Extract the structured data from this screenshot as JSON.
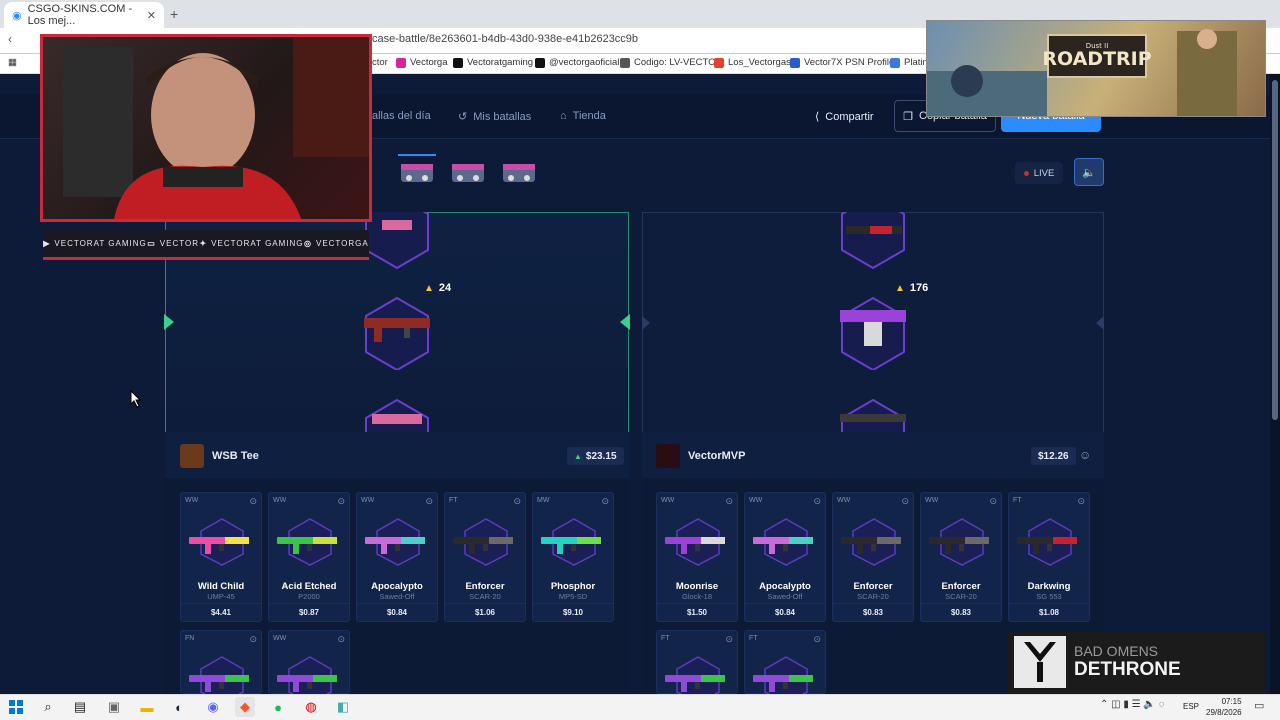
{
  "browser": {
    "tab_title": "CSGO-SKINS.COM - Los mej...",
    "url": "case-battle/8e263601-b4db-43d0-938e-e41b2623cc9b",
    "bookmarks": [
      "ctor",
      "Vectorga",
      "Vectoratgaming",
      "@vectorgaoficial",
      "Codigo: LV-VECTOR",
      "Los_Vectorgas",
      "Vector7X PSN Profile",
      "Platin"
    ]
  },
  "nav": {
    "battles_today": "allas del día",
    "my_battles": "Mis batallas",
    "store": "Tienda",
    "share": "Compartir",
    "copy_battle": "Copiar batalla",
    "new_battle": "Nueva batalla",
    "live": "LIVE"
  },
  "arena": {
    "left_reward": "24",
    "right_reward": "176"
  },
  "players": [
    {
      "name": "WSB Tee",
      "total": "$23.15",
      "items": [
        {
          "wear": "WW",
          "name": "Wild Child",
          "weapon": "UMP-45",
          "price": "$4.41"
        },
        {
          "wear": "WW",
          "name": "Acid Etched",
          "weapon": "P2000",
          "price": "$0.87"
        },
        {
          "wear": "WW",
          "name": "Apocalypto",
          "weapon": "Sawed-Off",
          "price": "$0.84"
        },
        {
          "wear": "FT",
          "name": "Enforcer",
          "weapon": "SCAR-20",
          "price": "$1.06"
        },
        {
          "wear": "MW",
          "name": "Phosphor",
          "weapon": "MP5-SD",
          "price": "$9.10"
        },
        {
          "wear": "FN",
          "name": "",
          "weapon": "",
          "price": ""
        },
        {
          "wear": "WW",
          "name": "",
          "weapon": "",
          "price": ""
        }
      ]
    },
    {
      "name": "VectorMVP",
      "total": "$12.26",
      "items": [
        {
          "wear": "WW",
          "name": "Moonrise",
          "weapon": "Glock-18",
          "price": "$1.50"
        },
        {
          "wear": "WW",
          "name": "Apocalypto",
          "weapon": "Sawed-Off",
          "price": "$0.84"
        },
        {
          "wear": "WW",
          "name": "Enforcer",
          "weapon": "SCAR-20",
          "price": "$0.83"
        },
        {
          "wear": "WW",
          "name": "Enforcer",
          "weapon": "SCAR-20",
          "price": "$0.83"
        },
        {
          "wear": "FT",
          "name": "Darkwing",
          "weapon": "SG 553",
          "price": "$1.08"
        },
        {
          "wear": "FT",
          "name": "",
          "weapon": "",
          "price": ""
        },
        {
          "wear": "FT",
          "name": "",
          "weapon": "",
          "price": ""
        }
      ]
    }
  ],
  "overlay": {
    "social": [
      "VECTORAT GAMING",
      "VECTOR",
      "VECTORAT GAMING",
      "VECTORGA"
    ],
    "game_title": "ROADTRIP",
    "game_subtitle": "Dust II",
    "artist": "BAD OMENS",
    "song": "DETHRONE"
  },
  "taskbar": {
    "lang": "ESP",
    "time": "07:15",
    "date": "29/8/2026"
  },
  "colors": {
    "accent": "#2b8bff",
    "winner_border": "#2a8d6a",
    "stream_frame": "#c62c3c"
  }
}
